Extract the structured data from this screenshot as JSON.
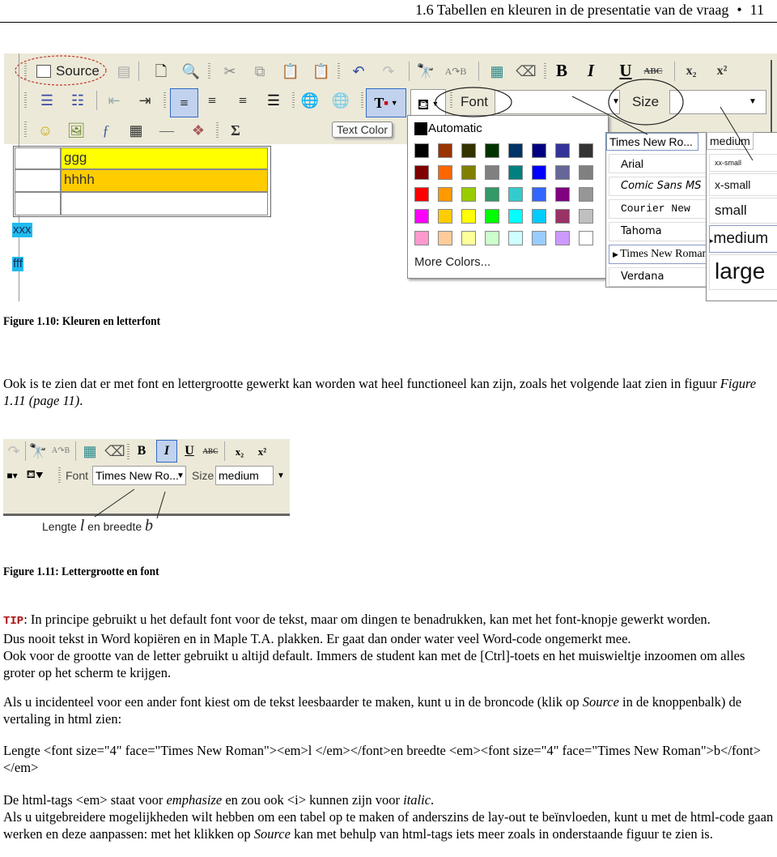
{
  "header": {
    "section_title": "1.6 Tabellen en kleuren in de presentatie van de vraag",
    "bullet": "•",
    "page_number": "11"
  },
  "figure_10": {
    "toolbar": {
      "source_label": "Source",
      "tooltip": "Text Color",
      "font_label": "Font",
      "size_label": "Size",
      "bold": "B",
      "italic": "I",
      "underline": "U",
      "spell": "ABC",
      "subscript": "x₂",
      "superscript": "x²",
      "sigma": "Σ"
    },
    "table_cells": [
      {
        "text": "",
        "bg": "#ffffff"
      },
      {
        "text": "ggg",
        "bg": "#ffff00"
      },
      {
        "text": "",
        "bg": "#ffffff"
      },
      {
        "text": "hhhh",
        "bg": "#ffcc00"
      },
      {
        "text": "",
        "bg": "#ffffff"
      },
      {
        "text": "",
        "bg": "#ffffff"
      }
    ],
    "highlighted_text": [
      "xxx",
      "fff"
    ],
    "highlight_color": "#1fbbef",
    "color_palette": {
      "automatic_label": "Automatic",
      "more_colors_label": "More Colors...",
      "colors": [
        "#000000",
        "#993300",
        "#333300",
        "#003300",
        "#003366",
        "#000080",
        "#333399",
        "#333333",
        "#800000",
        "#ff6600",
        "#808000",
        "#808080",
        "#008080",
        "#0000ff",
        "#666699",
        "#808080",
        "#ff0000",
        "#ff9900",
        "#99cc00",
        "#339966",
        "#33cccc",
        "#3366ff",
        "#800080",
        "#969696",
        "#ff00ff",
        "#ffcc00",
        "#ffff00",
        "#00ff00",
        "#00ffff",
        "#00ccff",
        "#993366",
        "#c0c0c0",
        "#ff99cc",
        "#ffcc99",
        "#ffff99",
        "#ccffcc",
        "#ccffff",
        "#99ccff",
        "#cc99ff",
        "#ffffff"
      ]
    },
    "font_combo": {
      "value": "Times New Ro...",
      "options": [
        "Arial",
        "Comic Sans MS",
        "Courier New",
        "Tahoma",
        "Times New Roman",
        "Verdana"
      ],
      "selected": "Times New Roman"
    },
    "size_combo": {
      "value": "medium",
      "options": [
        "xx-small",
        "x-small",
        "small",
        "medium",
        "large"
      ],
      "selected": "medium"
    },
    "caption": "Figure 1.10: Kleuren en letterfont"
  },
  "paragraph_1": {
    "text": "Ook is te zien dat er met font en lettergrootte gewerkt kan worden wat heel functioneel kan zijn, zoals het volgende laat zien in figuur",
    "link": "Figure 1.11 (page 11)",
    "end": "."
  },
  "figure_11": {
    "font_label": "Font",
    "font_value": "Times New Ro...",
    "size_label": "Size",
    "size_value": "medium",
    "bold": "B",
    "italic": "I",
    "underline": "U",
    "spell": "ABC",
    "subscript": "x₂",
    "superscript": "x²",
    "annotation_prefix": "Lengte",
    "annotation_l": "l",
    "annotation_mid": "en breedte",
    "annotation_b": "b",
    "caption": "Figure 1.11: Lettergrootte en font"
  },
  "tip": {
    "label": "TIP",
    "line1": ": In principe gebruikt u het default font voor de tekst, maar om dingen te benadrukken, kan met het font-knopje gewerkt worden.",
    "line2": "Dus nooit tekst in Word kopiëren en in Maple T.A. plakken. Er gaat dan onder water veel Word-code ongemerkt mee.",
    "line3": "Ook voor de grootte van de letter gebruikt u altijd default. Immers de student kan met de [Ctrl]-toets en het muiswieltje inzoomen om alles groter op het scherm te krijgen."
  },
  "paragraph_2": {
    "before": "Als u incidenteel voor een ander font kiest om de tekst leesbaarder te maken, kunt u in de broncode (klik op ",
    "em": "Source",
    "after": " in de knoppenbalk) de vertaling in html zien:"
  },
  "paragraph_3": {
    "text": "Lengte <font size=\"4\" face=\"Times New Roman\"><em>l </em></font>en breedte <em><font size=\"4\" face=\"Times New Roman\">b</font></em>"
  },
  "paragraph_4": {
    "a": "De html-tags <em> staat voor ",
    "em1": "emphasize",
    "b": " en zou ook <i> kunnen zijn voor ",
    "em2": "italic",
    "c": ".",
    "line2a": "Als u uitgebreidere mogelijkheden wilt hebben om een tabel op te maken of anderszins de lay-out te beïnvloeden, kunt u met de html-code gaan werken en deze aanpassen: met het klikken op ",
    "line2em": "Source",
    "line2b": " kan met behulp van html-tags iets meer zoals in onderstaande figuur te zien is."
  }
}
